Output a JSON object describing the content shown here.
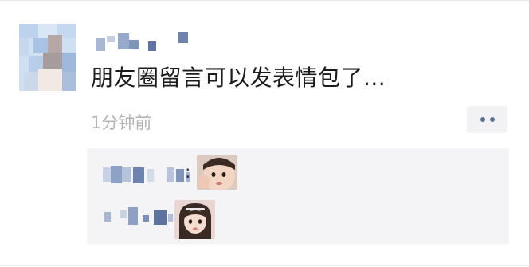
{
  "post": {
    "text": "朋友圈留言可以发表情包了...",
    "timestamp": "1分钟前"
  },
  "comments": [
    {
      "separator": ":"
    },
    {
      "separator": ""
    }
  ],
  "colors": {
    "text": "#1c1c1c",
    "timestamp": "#b3b3b3",
    "comment_bg": "#f4f4f6",
    "more_dots": "#5a6f92",
    "nickname_link": "#576b95"
  },
  "icons": [
    "more-icon",
    "avatar",
    "sticker-boy",
    "sticker-girl"
  ]
}
